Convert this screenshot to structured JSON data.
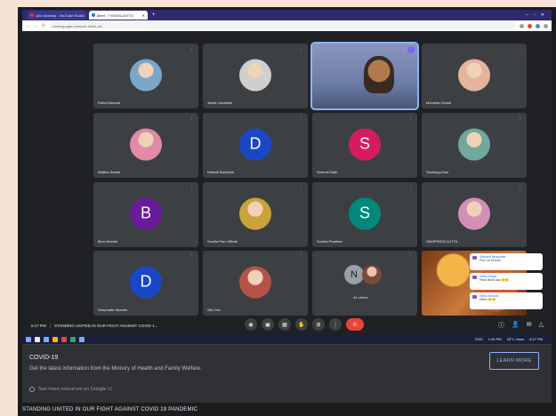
{
  "browser": {
    "tabs": [
      {
        "label": "Jolo Unnesty - YouTube Studio"
      },
      {
        "label": "Meet - TYHDSU-NTTD"
      }
    ],
    "new_tab": "+",
    "address": "meet.google.com/ucb-heDe-ct1",
    "window_controls": [
      "–",
      "▫",
      "✕"
    ]
  },
  "meet": {
    "participants": [
      {
        "name": "Rahul Mondal",
        "type": "photo",
        "color": "#7aa6c9"
      },
      {
        "name": "Jamie Jonathan",
        "type": "photo",
        "color": "#cfcfcf"
      },
      {
        "name": "",
        "type": "video",
        "color": "#6d7ea8"
      },
      {
        "name": "Moumita Ghosh",
        "type": "photo",
        "color": "#e5b49a"
      },
      {
        "name": "Mallika Sarkar",
        "type": "photo",
        "color": "#e28aa8"
      },
      {
        "name": "Debarti Banerjee",
        "type": "initial",
        "initial": "D",
        "color": "#1a47c8"
      },
      {
        "name": "Samrati Nath",
        "type": "initial",
        "initial": "S",
        "color": "#d81b60"
      },
      {
        "name": "Santanya Das",
        "type": "photo",
        "color": "#6fa89c"
      },
      {
        "name": "Binu Mondal",
        "type": "initial",
        "initial": "B",
        "color": "#6a1b9a"
      },
      {
        "name": "Sumita Pan Official",
        "type": "photo",
        "color": "#c9a33a"
      },
      {
        "name": "Sumita Pradhan",
        "type": "initial",
        "initial": "S",
        "color": "#00897b"
      },
      {
        "name": "SAMPRATA DUTTA",
        "type": "photo",
        "color": "#d48fb6"
      },
      {
        "name": "Deepmala Shadde",
        "type": "initial",
        "initial": "D",
        "color": "#1a47c8"
      },
      {
        "name": "Situ Sen",
        "type": "photo",
        "color": "#b5524a"
      },
      {
        "name": "44 others",
        "type": "group",
        "initial": "N",
        "color": "#5f6368"
      },
      {
        "name": "",
        "type": "scene",
        "color": "#b5632a"
      }
    ],
    "chat": [
      {
        "who": "Satvand Bhawnder",
        "text": "Phul na Khushi"
      },
      {
        "who": "Sarini Rayat",
        "text": "Hindi Bindi aaa 🙂🙂"
      },
      {
        "who": "Selsu Mondal",
        "text": "Hello! 🙂🙂"
      }
    ],
    "time": "5:17 PM",
    "meeting_title": "STANDING UNITED IN OUR FIGHT AGAINST COVID 1...",
    "controls": [
      "◉",
      "▣",
      "▦",
      "✋",
      "⊞",
      "⋮"
    ],
    "end_call": "✆",
    "right_controls": [
      "ⓘ",
      "👤",
      "✉",
      "△"
    ]
  },
  "taskbar": {
    "tray": [
      "ENG",
      "1:04 PM",
      "18°C Haze",
      "5:17 PM"
    ]
  },
  "covid": {
    "title": "COVID-19",
    "text": "Get the latest information from the Ministry of Health and Family Welfare.",
    "button": "LEARN MORE",
    "more": "See more resources on Google ☑"
  },
  "caption": "STANDING UNITED IN OUR FIGHT AGAINST COVID 19 PANDEMIC"
}
